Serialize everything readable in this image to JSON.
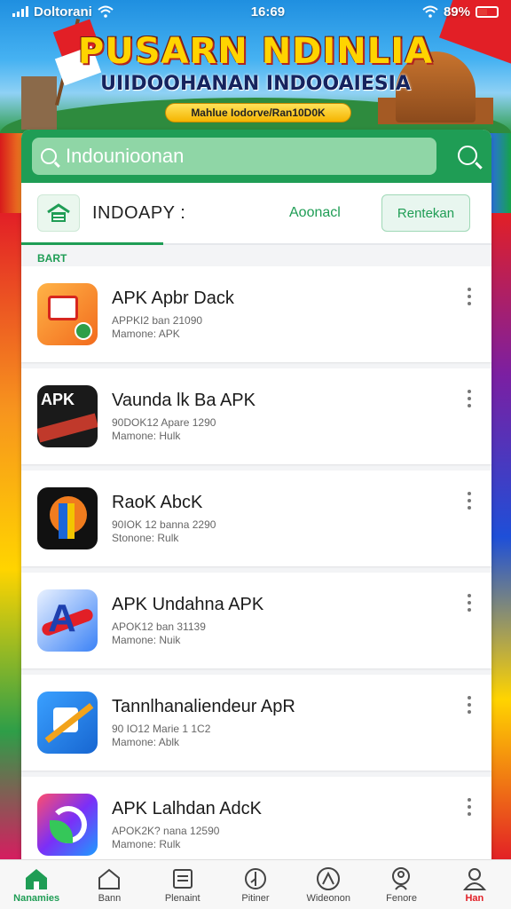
{
  "status_bar": {
    "carrier": "Doltorani",
    "time": "16:69",
    "battery": "89%"
  },
  "banner": {
    "title": "PUSARN NDINLIA",
    "subtitle": "UIIDOOHANAN INDOOAIESIA",
    "pill": "Mahlue Iodorve/Ran10D0K"
  },
  "search": {
    "placeholder": "Indounioonan"
  },
  "brand": {
    "name": "INDOAPY :",
    "link_label": "Aoonacl",
    "button_label": "Rentekan"
  },
  "section_label": "BART",
  "apps": [
    {
      "name": "APK Apbr Dack",
      "meta1": "APPKI2 ban 21090",
      "meta2": "Mamone: APK",
      "icon": "chat-bubble-icon"
    },
    {
      "name": "Vaunda lk Ba APK",
      "meta1": "90DOK12 Apare 1290",
      "meta2": "Mamone: Hulk",
      "icon": "apk-badge-icon"
    },
    {
      "name": "RaoK AbcK",
      "meta1": "90IOK 12 banna 2290",
      "meta2": "Stonone: Rulk",
      "icon": "letter-p-icon"
    },
    {
      "name": "APK Undahna APK",
      "meta1": "APOK12 ban 31139",
      "meta2": "Mamone: Nuik",
      "icon": "letter-a-icon"
    },
    {
      "name": "Tannlhanaliendeur ApR",
      "meta1": "90 IO12 Marie 1 1C2 ",
      "meta2": "Mamone: Ablk",
      "icon": "bat-icon"
    },
    {
      "name": "APK Lalhdan AdcK",
      "meta1": "APOK2K? nana 12590",
      "meta2": "Mamone: Rulk",
      "icon": "swirl-icon"
    }
  ],
  "nav": [
    {
      "label": "Nanamies",
      "icon": "home-icon",
      "state": "active"
    },
    {
      "label": "Bann",
      "icon": "house-outline-icon",
      "state": "normal"
    },
    {
      "label": "Plenaint",
      "icon": "document-icon",
      "state": "normal"
    },
    {
      "label": "Pitiner",
      "icon": "compass-icon",
      "state": "normal"
    },
    {
      "label": "Wideonon",
      "icon": "globe-icon",
      "state": "normal"
    },
    {
      "label": "Fenore",
      "icon": "search-person-icon",
      "state": "normal"
    },
    {
      "label": "Han",
      "icon": "profile-icon",
      "state": "alert"
    }
  ],
  "colors": {
    "primary_green": "#1f9d55",
    "alert_red": "#e21f26"
  }
}
